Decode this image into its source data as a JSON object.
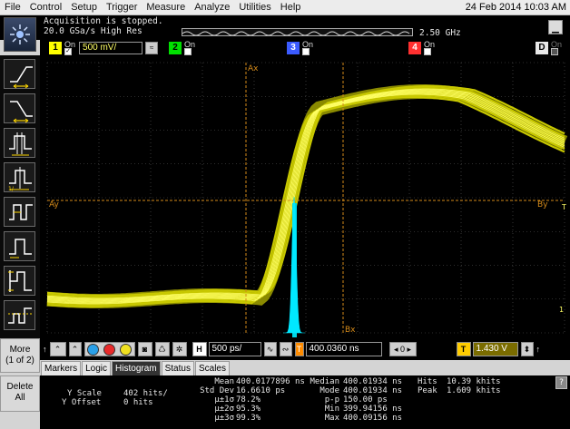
{
  "menu": {
    "items": [
      "File",
      "Control",
      "Setup",
      "Trigger",
      "Measure",
      "Analyze",
      "Utilities",
      "Help"
    ],
    "datetime": "24 Feb 2014 10:03 AM"
  },
  "status": {
    "acq_line1": "Acquisition is stopped.",
    "acq_line2": "20.0 GSa/s   High Res",
    "bandwidth": "2.50 GHz"
  },
  "channels": {
    "ch1": {
      "num": "1",
      "on_label": "On",
      "scale": "500 mV/",
      "color": "#ffff00",
      "checked": true
    },
    "ch2": {
      "num": "2",
      "on_label": "On",
      "color": "#00ff00",
      "checked": false
    },
    "ch3": {
      "num": "3",
      "on_label": "On",
      "color": "#3b5bff",
      "checked": false
    },
    "ch4": {
      "num": "4",
      "on_label": "On",
      "color": "#ff3030",
      "checked": false
    },
    "digital": {
      "num": "D",
      "on_label": "On"
    }
  },
  "sidebar": {
    "more_label": "More",
    "more_page": "(1 of 2)",
    "delete_label": "Delete",
    "all_label": "All"
  },
  "screen": {
    "marker_ax": "Ax",
    "marker_bx": "Bx",
    "marker_ay": "Ay",
    "marker_by": "By",
    "trigger_marker": "T",
    "ch1_ground": "1"
  },
  "controls": {
    "horizontal_label": "H",
    "timebase": "500 ps/",
    "trigger_badge": "T",
    "delay": "400.0360 ns",
    "trigger_level_badge": "T",
    "trigger_level": "1.430 V"
  },
  "tabs": [
    "Markers",
    "Logic",
    "Histogram",
    "Status",
    "Scales"
  ],
  "active_tab": "Histogram",
  "histogram": {
    "y_scale_label": "Y Scale",
    "y_scale_value": "402 hits/",
    "y_offset_label": "Y Offset",
    "y_offset_value": "0 hits",
    "mean_label": "Mean",
    "mean_value": "400.0177896 ns",
    "stddev_label": "Std Dev",
    "stddev_value": "16.6610 ps",
    "s1_label": "μ±1σ",
    "s1_value": "78.2%",
    "s2_label": "μ±2σ",
    "s2_value": "95.3%",
    "s3_label": "μ±3σ",
    "s3_value": "99.3%",
    "median_label": "Median",
    "median_value": "400.01934 ns",
    "mode_label": "Mode",
    "mode_value": "400.01934 ns",
    "pp_label": "p-p",
    "pp_value": "150.00 ps",
    "min_label": "Min",
    "min_value": "399.94156 ns",
    "max_label": "Max",
    "max_value": "400.09156 ns",
    "hits_label": "Hits",
    "hits_value": "10.39 khits",
    "peak_label": "Peak",
    "peak_value": "1.609 khits",
    "help": "?"
  }
}
